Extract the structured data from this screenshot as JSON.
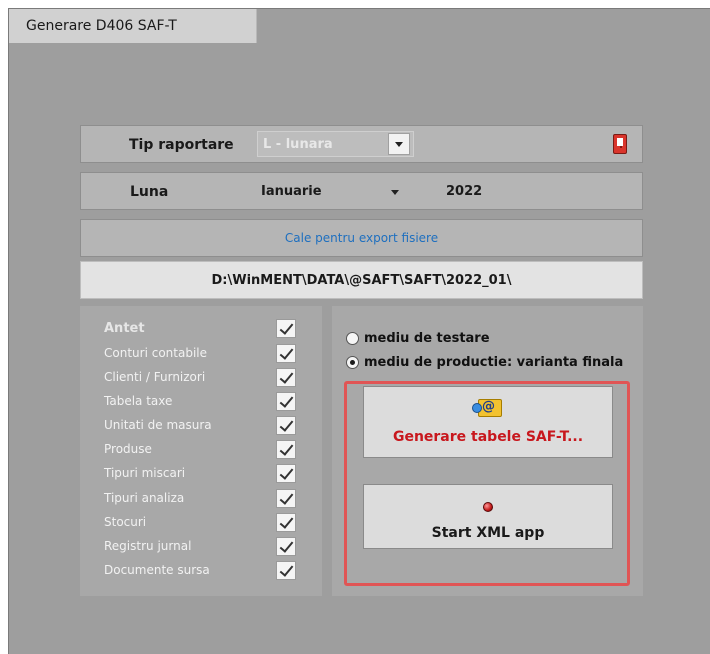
{
  "window": {
    "tab_title": "Generare D406 SAF-T"
  },
  "tip_raportare": {
    "label": "Tip raportare",
    "value": "L - lunara"
  },
  "luna": {
    "label": "Luna",
    "month": "Ianuarie",
    "year": "2022"
  },
  "export": {
    "header": "Cale pentru export fisiere",
    "path": "D:\\WinMENT\\DATA\\@SAFT\\SAFT\\2022_01\\"
  },
  "tables": [
    {
      "label": "Antet",
      "checked": true
    },
    {
      "label": "Conturi contabile",
      "checked": true
    },
    {
      "label": "Clienti / Furnizori",
      "checked": true
    },
    {
      "label": "Tabela taxe",
      "checked": true
    },
    {
      "label": "Unitati de masura",
      "checked": true
    },
    {
      "label": "Produse",
      "checked": true
    },
    {
      "label": "Tipuri miscari",
      "checked": true
    },
    {
      "label": "Tipuri analiza",
      "checked": true
    },
    {
      "label": "Stocuri",
      "checked": true
    },
    {
      "label": "Registru jurnal",
      "checked": true
    },
    {
      "label": "Documente sursa",
      "checked": true
    }
  ],
  "environment": {
    "options": [
      {
        "label": "mediu de testare",
        "selected": false
      },
      {
        "label": "mediu de productie: varianta finala",
        "selected": true
      }
    ]
  },
  "actions": {
    "generate_label": "Generare tabele SAF-T...",
    "start_label": "Start XML app"
  },
  "colors": {
    "highlight": "#e05555",
    "generate_text": "#c8171d",
    "link_text": "#1e6fbf"
  }
}
